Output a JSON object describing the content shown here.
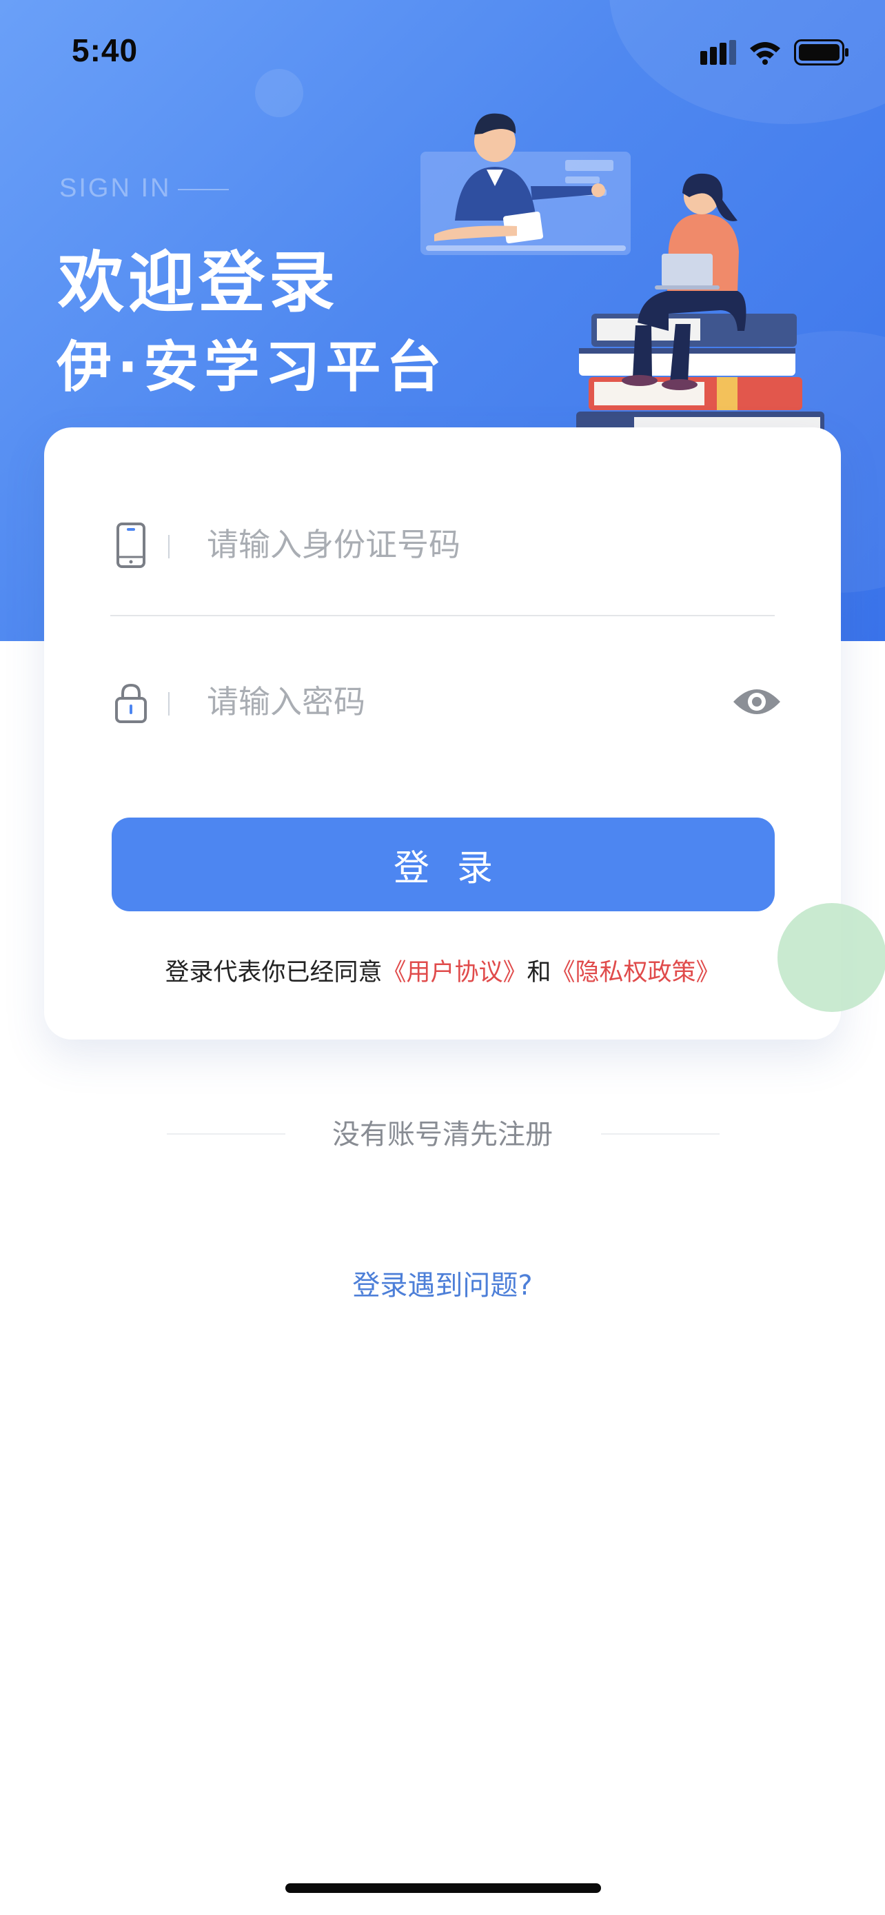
{
  "status_bar": {
    "time": "5:40"
  },
  "hero": {
    "eyebrow": "SIGN IN",
    "title": "欢迎登录",
    "subtitle": "伊·安学习平台"
  },
  "form": {
    "id_placeholder": "请输入身份证号码",
    "password_placeholder": "请输入密码",
    "login_label": "登录",
    "agreement_prefix": "登录代表你已经同意",
    "user_agreement": "《用户协议》",
    "agreement_and": "和",
    "privacy_policy": "《隐私权政策》"
  },
  "register_text": "没有账号清先注册",
  "problem_text": "登录遇到问题?",
  "colors": {
    "primary": "#4d86f1",
    "link_red": "#e04b4b",
    "link_blue": "#4d7fd8",
    "hero_gradient": "#4f88f0"
  },
  "icons": [
    "signal-icon",
    "wifi-icon",
    "battery-icon",
    "phone-icon",
    "lock-icon",
    "eye-icon"
  ]
}
